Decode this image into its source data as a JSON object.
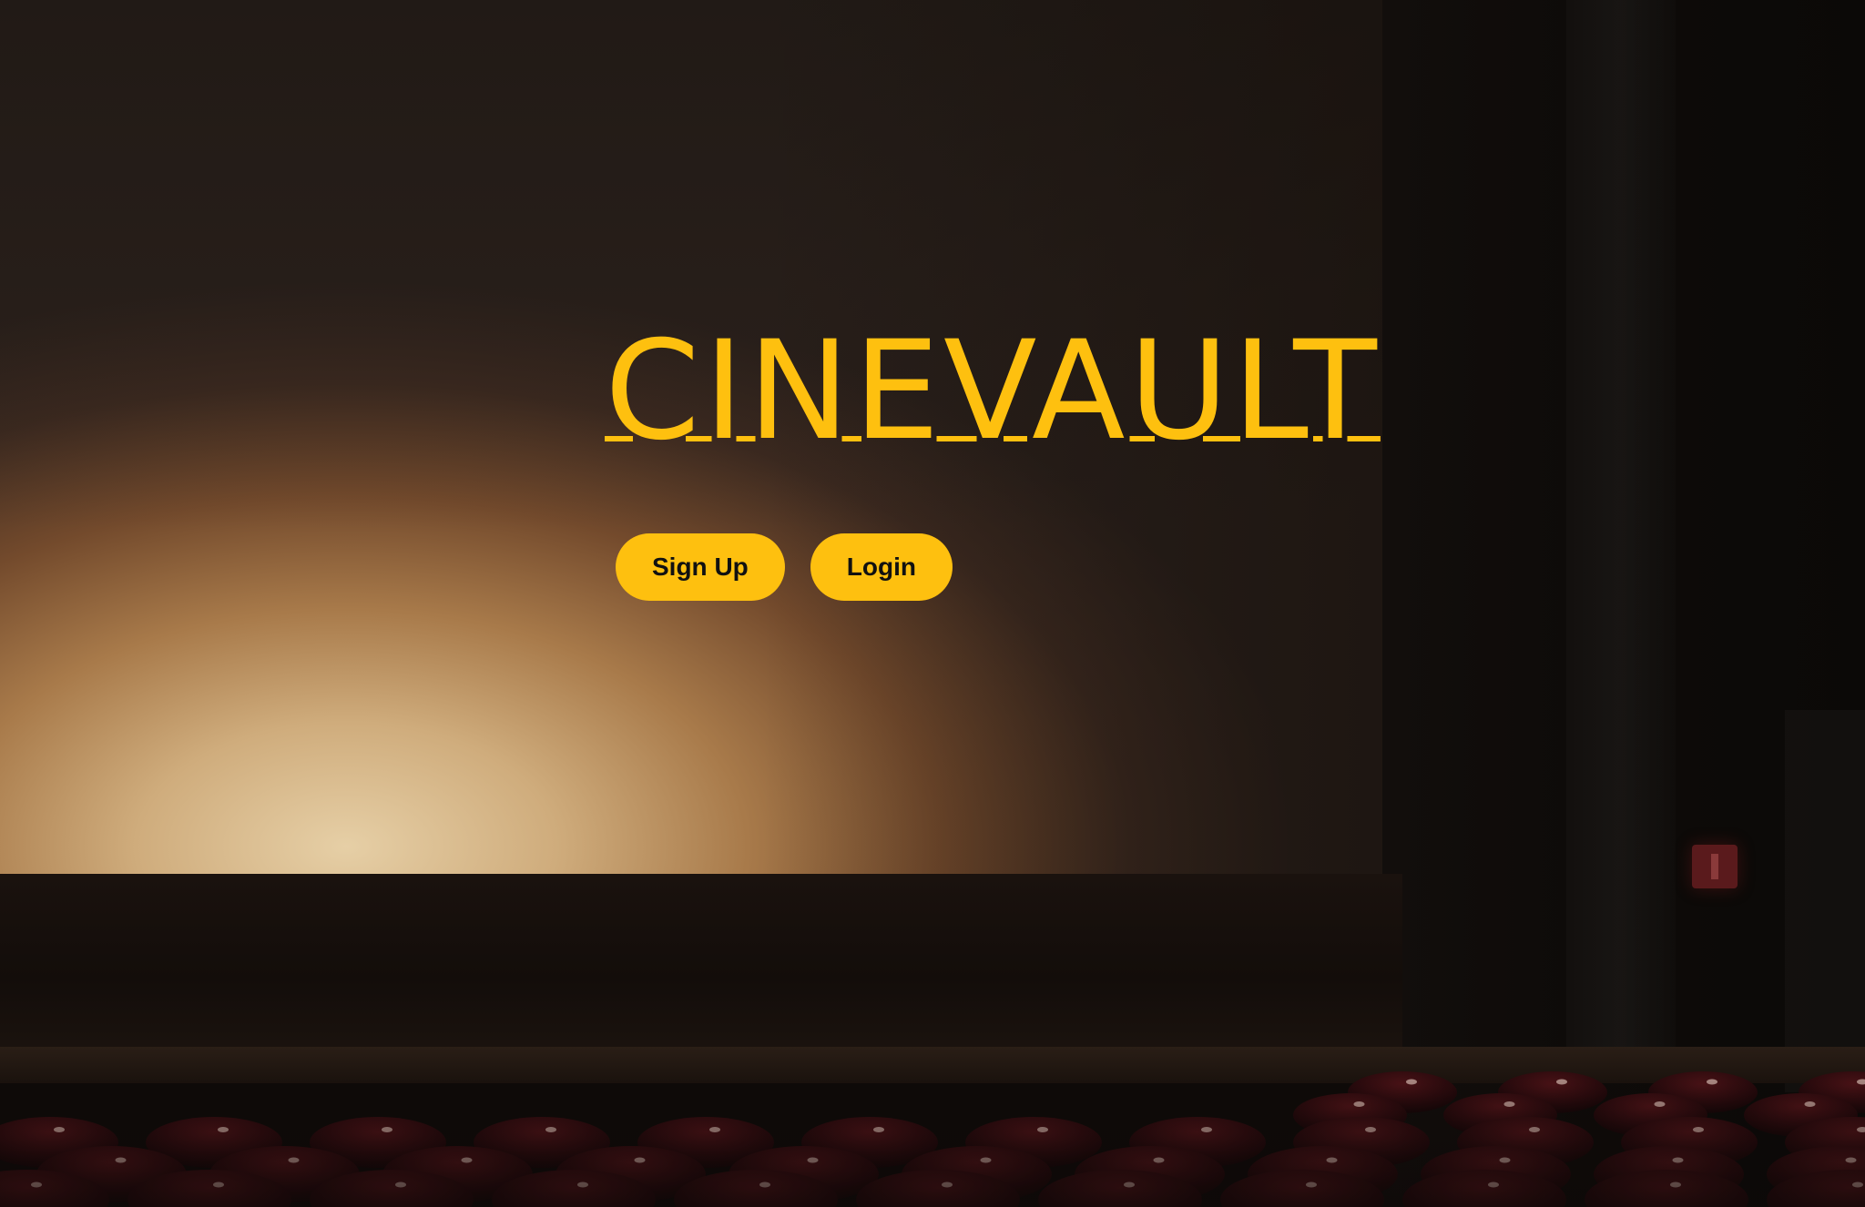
{
  "brand": {
    "title": "CINEVAULT"
  },
  "actions": {
    "signup_label": "Sign Up",
    "login_label": "Login"
  },
  "theme": {
    "accent": "#fec00f",
    "button_text": "#111111"
  }
}
